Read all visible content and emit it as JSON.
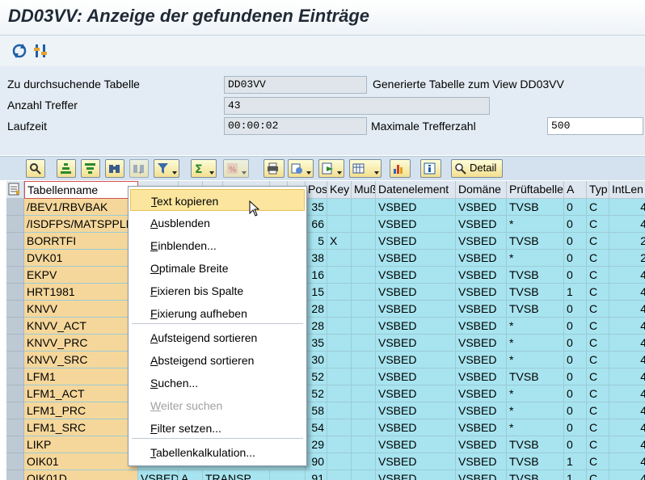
{
  "window": {
    "title": "DD03VV: Anzeige der gefundenen Einträge"
  },
  "app_toolbar": {
    "icons": [
      "refresh-icon",
      "settings-icon"
    ]
  },
  "form": {
    "table_label": "Zu durchsuchende Tabelle",
    "table_value": "DD03VV",
    "table_desc": "Generierte Tabelle zum View DD03VV",
    "hits_label": "Anzahl Treffer",
    "hits_value": "43",
    "runtime_label": "Laufzeit",
    "runtime_value": "00:00:02",
    "max_label": "Maximale Trefferzahl",
    "max_value": "500"
  },
  "alv_toolbar": {
    "buttons": [
      "details-icon",
      "sort-ascending-icon",
      "sort-descending-icon",
      "find-icon",
      "find-next-icon",
      "filter-icon",
      "sum-icon",
      "subtotal-icon",
      "print-icon",
      "views-icon",
      "export-icon",
      "layout-icon",
      "graphic-icon",
      "info-icon"
    ],
    "detail_label": "Detail"
  },
  "table": {
    "columns": [
      "Tabellenname",
      "",
      "",
      "Pos",
      "Key",
      "Muß",
      "Datenelement",
      "Domäne",
      "Prüftabelle",
      "A",
      "Typ",
      "IntLen"
    ],
    "rows": [
      [
        "/BEV1/RBVBAK",
        "35",
        "",
        "",
        "VSBED",
        "VSBED",
        "TVSB",
        "0",
        "C",
        "4"
      ],
      [
        "/ISDFPS/MATSPPLI",
        "66",
        "",
        "",
        "VSBED",
        "VSBED",
        "*",
        "0",
        "C",
        "4"
      ],
      [
        "BORRTFI",
        "5",
        "X",
        "",
        "VSBED",
        "VSBED",
        "TVSB",
        "0",
        "C",
        "2"
      ],
      [
        "DVK01",
        "38",
        "",
        "",
        "VSBED",
        "VSBED",
        "*",
        "0",
        "C",
        "2"
      ],
      [
        "EKPV",
        "16",
        "",
        "",
        "VSBED",
        "VSBED",
        "TVSB",
        "0",
        "C",
        "4"
      ],
      [
        "HRT1981",
        "15",
        "",
        "",
        "VSBED",
        "VSBED",
        "TVSB",
        "1",
        "C",
        "4"
      ],
      [
        "KNVV",
        "28",
        "",
        "",
        "VSBED",
        "VSBED",
        "TVSB",
        "0",
        "C",
        "4"
      ],
      [
        "KNVV_ACT",
        "28",
        "",
        "",
        "VSBED",
        "VSBED",
        "*",
        "0",
        "C",
        "4"
      ],
      [
        "KNVV_PRC",
        "35",
        "",
        "",
        "VSBED",
        "VSBED",
        "*",
        "0",
        "C",
        "4"
      ],
      [
        "KNVV_SRC",
        "30",
        "",
        "",
        "VSBED",
        "VSBED",
        "*",
        "0",
        "C",
        "4"
      ],
      [
        "LFM1",
        "52",
        "",
        "",
        "VSBED",
        "VSBED",
        "TVSB",
        "0",
        "C",
        "4"
      ],
      [
        "LFM1_ACT",
        "52",
        "",
        "",
        "VSBED",
        "VSBED",
        "*",
        "0",
        "C",
        "4"
      ],
      [
        "LFM1_PRC",
        "58",
        "",
        "",
        "VSBED",
        "VSBED",
        "*",
        "0",
        "C",
        "4"
      ],
      [
        "LFM1_SRC",
        "54",
        "",
        "",
        "VSBED",
        "VSBED",
        "*",
        "0",
        "C",
        "4"
      ],
      [
        "LIKP",
        "29",
        "",
        "",
        "VSBED",
        "VSBED",
        "TVSB",
        "0",
        "C",
        "4"
      ],
      [
        "OIK01",
        "90",
        "",
        "",
        "VSBED",
        "VSBED",
        "TVSB",
        "1",
        "C",
        "4"
      ]
    ],
    "partial_row": [
      "OIK01D",
      "VSBED",
      "A",
      "TRANSP",
      "91",
      "",
      "",
      "VSBED",
      "VSBED",
      "TVSB",
      "1",
      "C",
      "4"
    ]
  },
  "context_menu": {
    "items": [
      {
        "label": "Text kopieren",
        "accel": "T",
        "rest": "ext kopieren"
      },
      {
        "label": "Ausblenden",
        "accel": "A",
        "rest": "usblenden"
      },
      {
        "label": "Einblenden...",
        "accel": "E",
        "rest": "inblenden..."
      },
      {
        "label": "Optimale Breite",
        "accel": "O",
        "rest": "ptimale Breite"
      },
      {
        "label": "Fixieren bis Spalte",
        "accel": "F",
        "rest": "ixieren bis Spalte"
      },
      {
        "label": "Fixierung aufheben",
        "accel": "F",
        "rest": "ixierung aufheben"
      },
      {
        "label": "Aufsteigend sortieren",
        "accel": "A",
        "rest": "ufsteigend sortieren"
      },
      {
        "label": "Absteigend sortieren",
        "accel": "A",
        "rest": "bsteigend sortieren"
      },
      {
        "label": "Suchen...",
        "accel": "S",
        "rest": "uchen..."
      },
      {
        "label": "Weiter suchen",
        "accel": "W",
        "rest": "eiter suchen"
      },
      {
        "label": "Filter setzen...",
        "accel": "F",
        "rest": "ilter setzen..."
      },
      {
        "label": "Tabellenkalkulation...",
        "accel": "T",
        "rest": "abellenkalkulation..."
      }
    ]
  },
  "colors": {
    "key_column": "#f5d79b",
    "data_cells": "#a7e4ef",
    "menu_hover": "#fce69f"
  }
}
